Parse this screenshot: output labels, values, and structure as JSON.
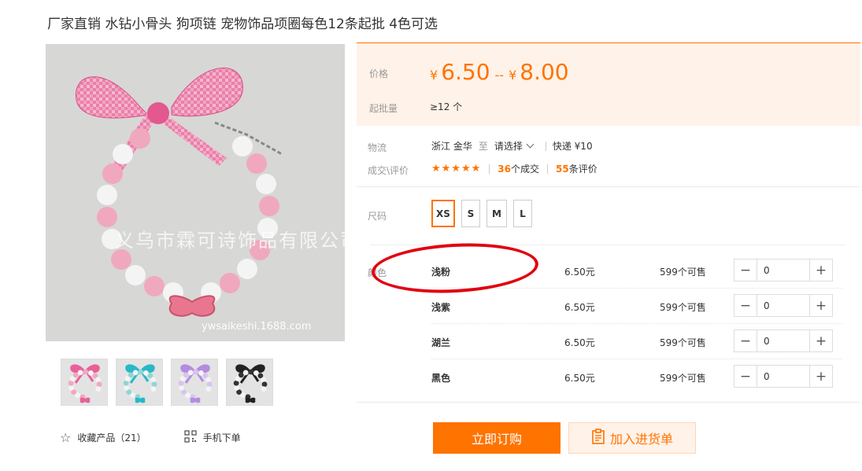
{
  "product": {
    "title": "厂家直销 水钻小骨头 狗项链 宠物饰品项圈每色12条起批 4色可选"
  },
  "image": {
    "watermark": "义乌市霖可诗饰品有限公司",
    "watermark_url": "ywsaikeshi.1688.com"
  },
  "thumbnails": [
    {
      "ribbon": "#e8609a",
      "bead": "#f0a8bf"
    },
    {
      "ribbon": "#28b8c8",
      "bead": "#8fd6d2"
    },
    {
      "ribbon": "#b48be0",
      "bead": "#d9c3f0"
    },
    {
      "ribbon": "#222222",
      "bead": "#333333"
    }
  ],
  "actions_left": {
    "favorite": "收藏产品（21）",
    "mobile": "手机下单"
  },
  "price": {
    "label": "价格",
    "currency": "¥",
    "min": "6.50",
    "separator": "--",
    "max": "8.00",
    "moq_label": "起批量",
    "moq": "≥12 个"
  },
  "logistics": {
    "label": "物流",
    "origin": "浙江 金华",
    "to": "至",
    "dest": "请选择",
    "express": "快递 ¥10"
  },
  "deal": {
    "label": "成交\\评价",
    "stars": "★★★★★",
    "sold_num": "36",
    "sold_text": "个成交",
    "review_num": "55",
    "review_text": "条评价"
  },
  "size": {
    "label": "尺码",
    "options": [
      "XS",
      "S",
      "M",
      "L"
    ],
    "selected": "XS"
  },
  "color": {
    "label": "颜色",
    "rows": [
      {
        "name": "浅粉",
        "price": "6.50元",
        "stock": "599个可售",
        "qty": "0"
      },
      {
        "name": "浅紫",
        "price": "6.50元",
        "stock": "599个可售",
        "qty": "0"
      },
      {
        "name": "湖兰",
        "price": "6.50元",
        "stock": "599个可售",
        "qty": "0"
      },
      {
        "name": "黑色",
        "price": "6.50元",
        "stock": "599个可售",
        "qty": "0"
      }
    ]
  },
  "buttons": {
    "buy": "立即订购",
    "cart": "加入进货单"
  },
  "colors": {
    "accent": "#ff7300",
    "price_bg": "#fff2e8",
    "annotation": "#e10010"
  }
}
